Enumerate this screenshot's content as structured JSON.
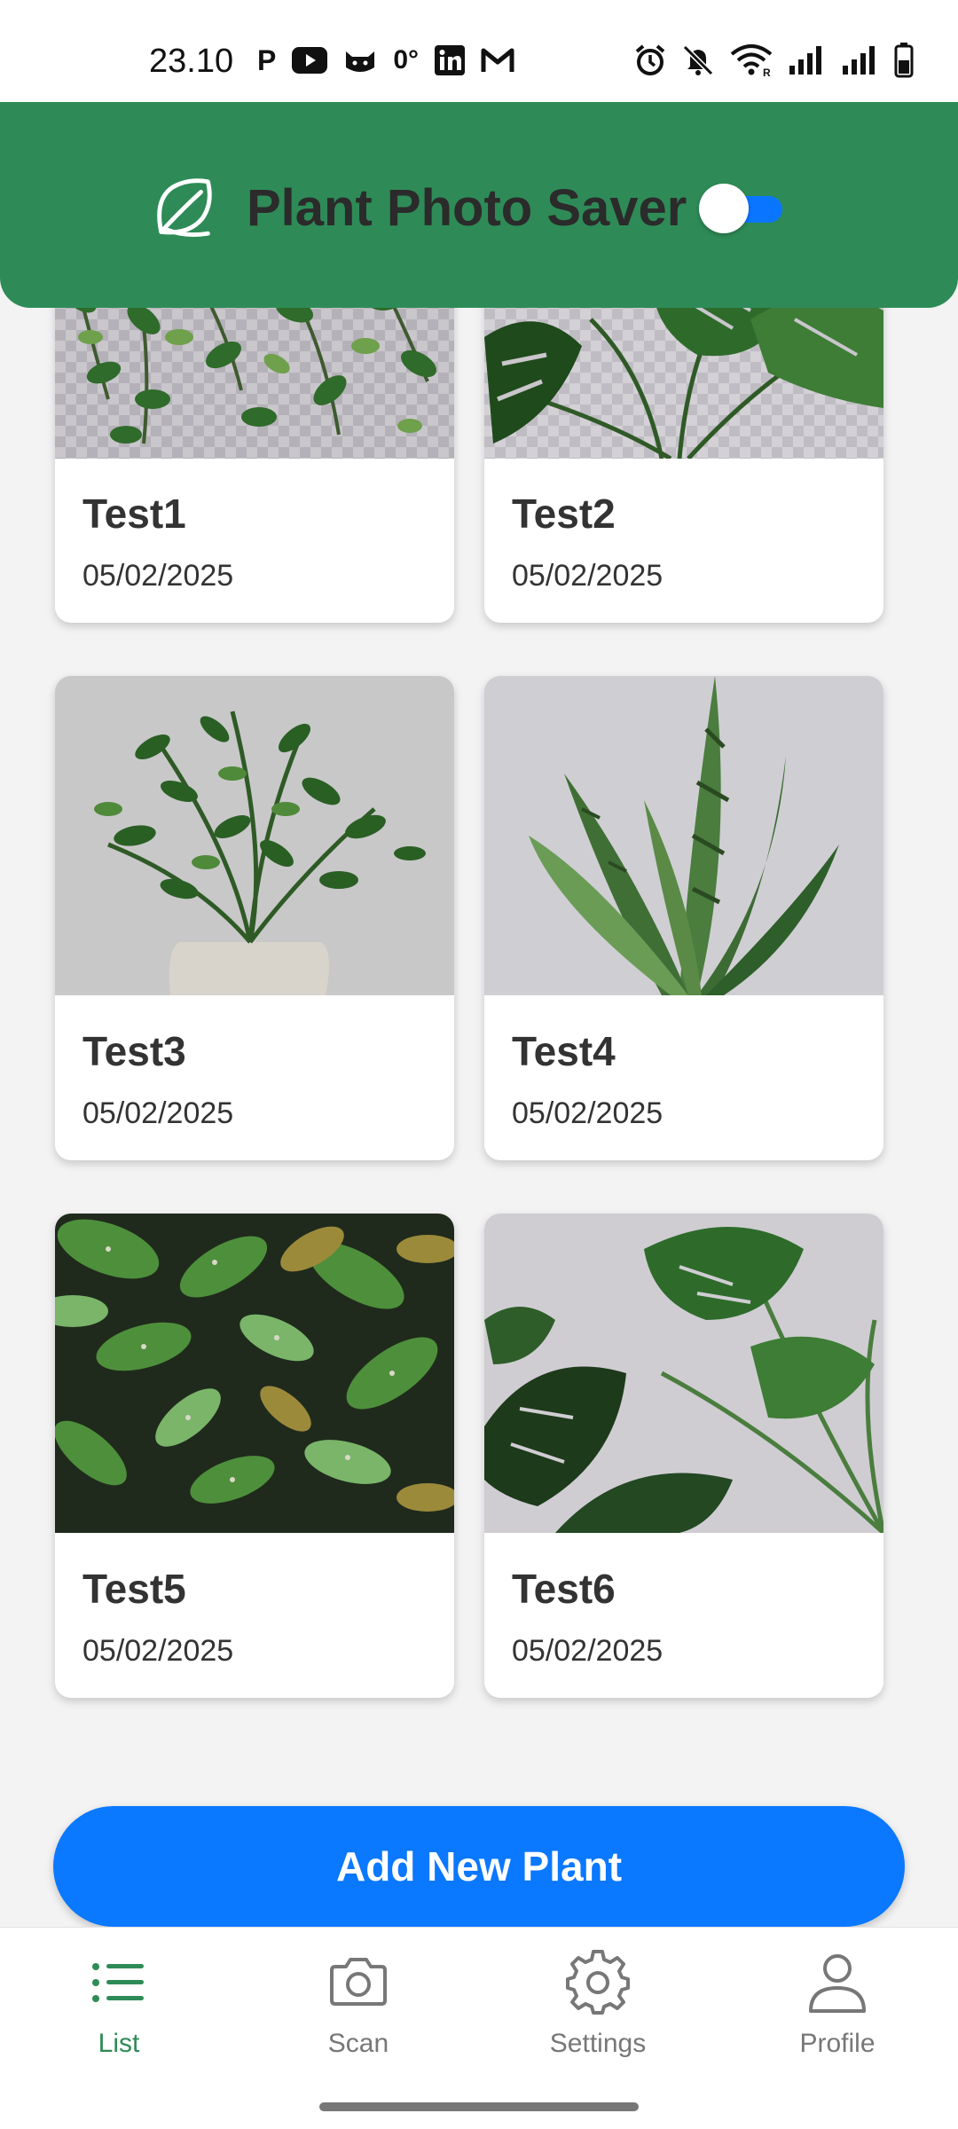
{
  "status_bar": {
    "time": "23.10",
    "left_icons": [
      "parking-icon",
      "youtube-icon",
      "cat-icon",
      "temperature-icon",
      "linkedin-icon",
      "gmail-icon"
    ],
    "temperature": "0°",
    "right_icons": [
      "alarm-icon",
      "mute-icon",
      "wifi-icon",
      "signal-icon",
      "signal-icon",
      "battery-icon"
    ]
  },
  "header": {
    "title": "Plant Photo Saver",
    "toggle_on": true,
    "background_color": "#2e8b57",
    "toggle_color": "#0a76ff"
  },
  "plants": [
    {
      "name": "Test1",
      "date": "05/02/2025",
      "photo": "pothos-vine"
    },
    {
      "name": "Test2",
      "date": "05/02/2025",
      "photo": "monstera"
    },
    {
      "name": "Test3",
      "date": "05/02/2025",
      "photo": "zz-plant"
    },
    {
      "name": "Test4",
      "date": "05/02/2025",
      "photo": "snake-plant"
    },
    {
      "name": "Test5",
      "date": "05/02/2025",
      "photo": "spotted-foliage"
    },
    {
      "name": "Test6",
      "date": "05/02/2025",
      "photo": "monstera-leaves"
    }
  ],
  "add_button": {
    "label": "Add New Plant",
    "color": "#0a78ff"
  },
  "nav": {
    "items": [
      {
        "label": "List",
        "icon": "list-icon",
        "active": true
      },
      {
        "label": "Scan",
        "icon": "camera-icon",
        "active": false
      },
      {
        "label": "Settings",
        "icon": "gear-icon",
        "active": false
      },
      {
        "label": "Profile",
        "icon": "person-icon",
        "active": false
      }
    ],
    "active_color": "#2e8b57"
  }
}
